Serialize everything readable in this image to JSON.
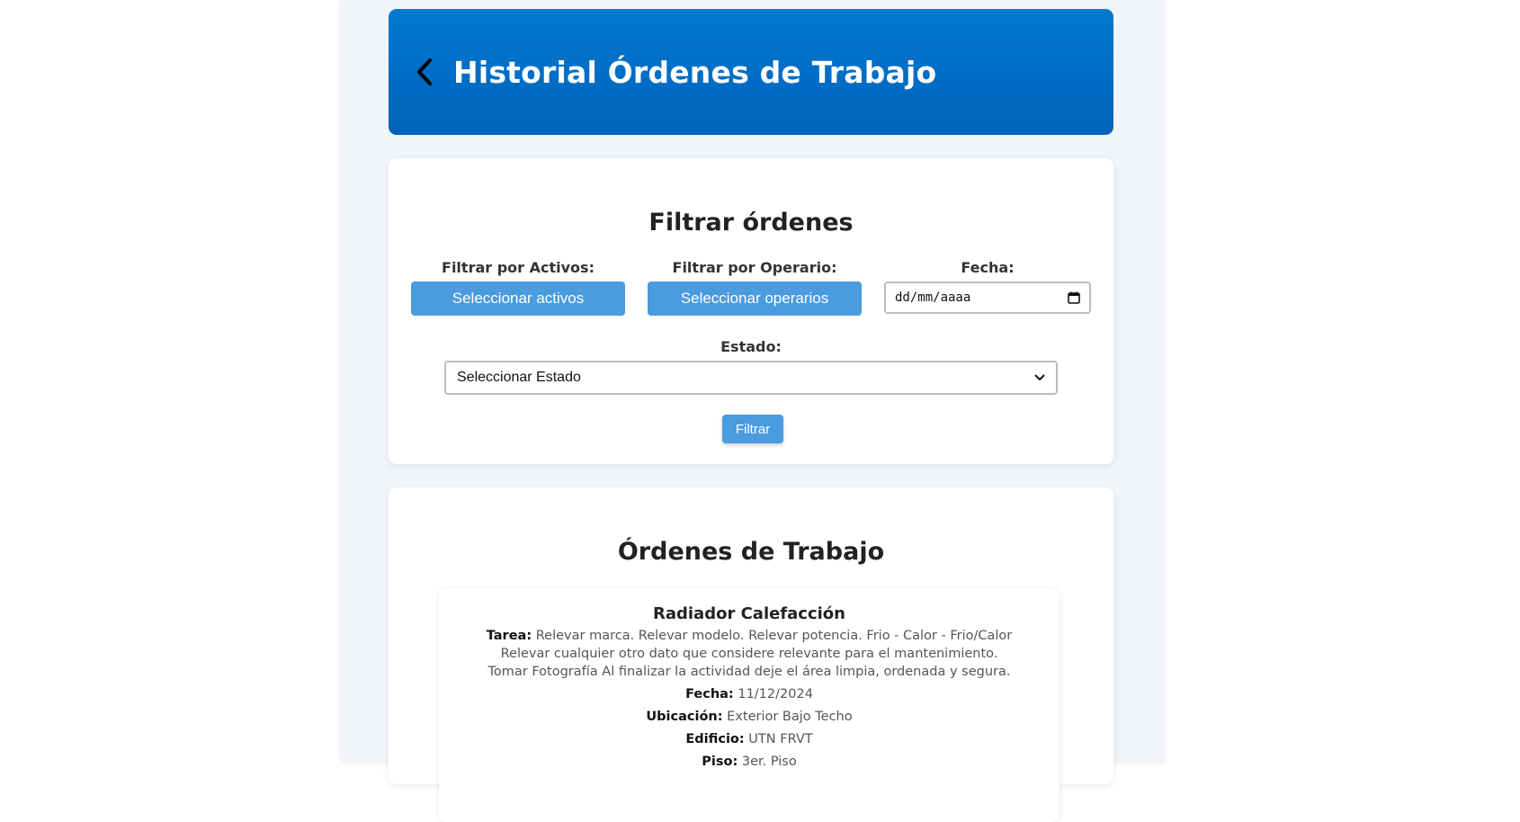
{
  "header": {
    "title": "Historial Órdenes de Trabajo"
  },
  "filters": {
    "title": "Filtrar órdenes",
    "activos_label": "Filtrar por Activos:",
    "activos_button": "Seleccionar activos",
    "operario_label": "Filtrar por Operario:",
    "operario_button": "Seleccionar operarios",
    "fecha_label": "Fecha:",
    "fecha_placeholder": "dd/mm/aaaa",
    "estado_label": "Estado:",
    "estado_selected": "Seleccionar Estado",
    "filter_button": "Filtrar"
  },
  "orders": {
    "title": "Órdenes de Trabajo",
    "items": [
      {
        "name": "Radiador Calefacción",
        "tarea_label": "Tarea:",
        "tarea": "Relevar marca. Relevar modelo. Relevar potencia. Frio - Calor - Frio/Calor Relevar cualquier otro dato que considere relevante para el mantenimiento. Tomar Fotografía Al finalizar la actividad deje el área limpia, ordenada y segura.",
        "fecha_label": "Fecha:",
        "fecha": "11/12/2024",
        "ubicacion_label": "Ubicación:",
        "ubicacion": "Exterior Bajo Techo",
        "edificio_label": "Edificio:",
        "edificio": "UTN FRVT",
        "piso_label": "Piso:",
        "piso": "3er. Piso"
      }
    ]
  },
  "icons": {
    "back": "chevron-left-icon",
    "calendar": "calendar-icon",
    "dropdown": "chevron-down-icon"
  },
  "colors": {
    "header_top": "#0179d0",
    "header_bottom": "#0063bb",
    "button": "#4a9be0",
    "background": "#f1f4f9"
  }
}
